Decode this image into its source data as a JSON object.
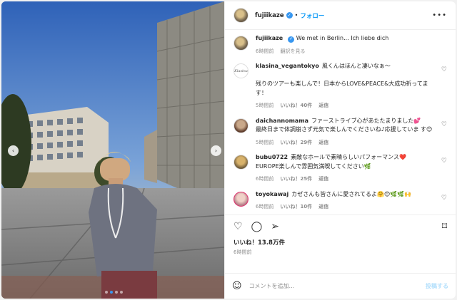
{
  "header": {
    "username": "fujiikaze",
    "separator": "•",
    "follow_label": "フォロー",
    "more_label": "•••"
  },
  "caption": {
    "username": "fujiikaze",
    "text": "We met in Berlin... Ich liebe dich",
    "time": "6時間前",
    "translate_label": "翻訳を見る"
  },
  "comments": [
    {
      "username": "klasina_vegantokyo",
      "avatar_text": "Klasina",
      "text": "風くんはほんと凄いなぁ〜\n\n残りのツアーも楽しんで！日本からLOVE&PEACE&大成功祈ってます！",
      "time": "5時間前",
      "likes": "いいね！40件",
      "reply": "返信"
    },
    {
      "username": "daichannomama",
      "text": "ファーストライブ心があたたまりました💕\n最終日まで体調崩さず元気で楽しんでくださいね♪応援していま す😊",
      "time": "5時間前",
      "likes": "いいね！29件",
      "reply": "返信"
    },
    {
      "username": "bubu0722",
      "text": "素敵なホールで素晴らしいパフォーマンス❤️\nEUROPE楽しんで雰囲気満喫してください🌿",
      "time": "6時間前",
      "likes": "いいね！25件",
      "reply": "返信"
    },
    {
      "username": "toyokawaj",
      "text": "カゼさんも皆さんに愛されてるよ🤗😊🌿🌿🙌",
      "time": "6時間前",
      "likes": "いいね！10件",
      "reply": "返信"
    }
  ],
  "actions": {
    "likes_total": "いいね！13.8万件",
    "post_time": "6時間前"
  },
  "composer": {
    "placeholder": "コメントを追加...",
    "post_label": "投稿する"
  },
  "icons": {
    "heart": "♡",
    "comment": "◯",
    "share": "➢",
    "bookmark": "⌑",
    "emoji": "☺",
    "prev": "‹",
    "next": "›"
  },
  "carousel": {
    "slides": 4,
    "active": 2
  }
}
